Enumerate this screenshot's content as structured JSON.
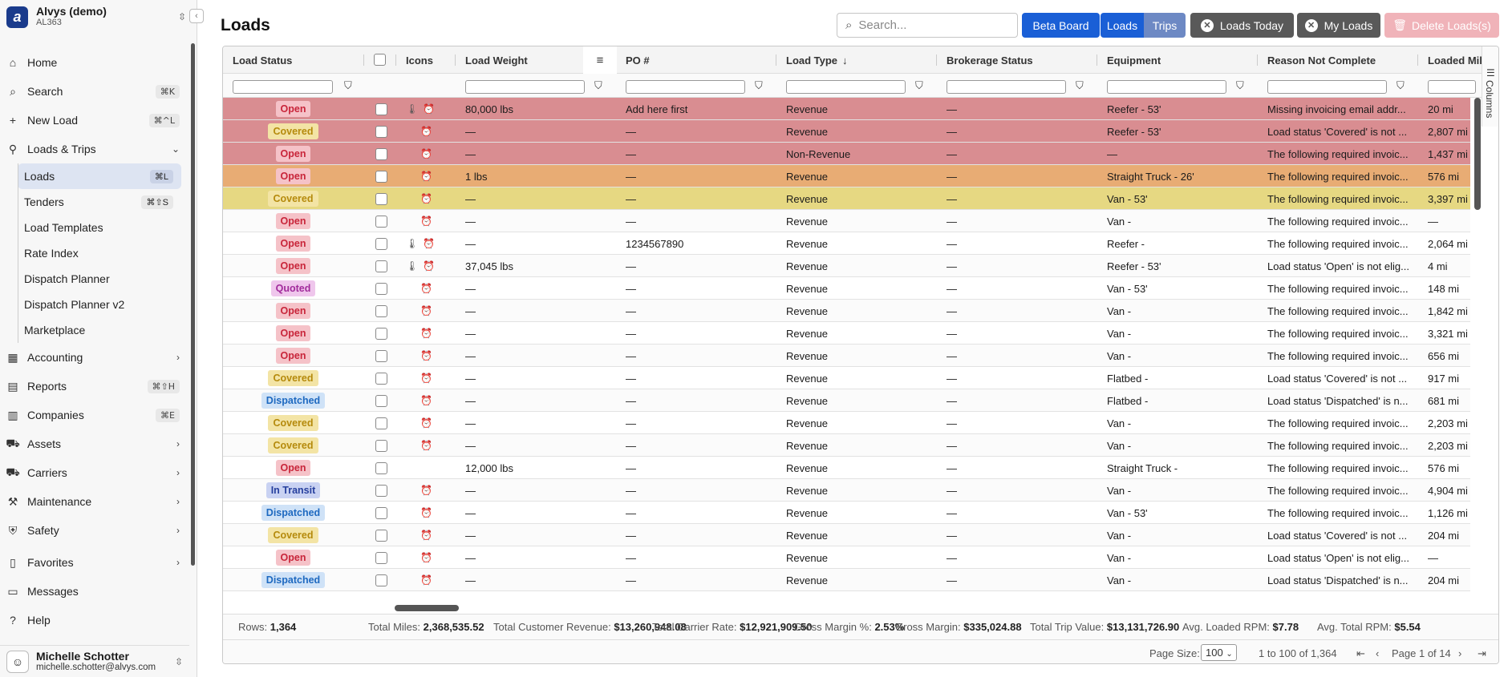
{
  "org": {
    "name": "Alvys (demo)",
    "code": "AL363"
  },
  "nav": {
    "home": {
      "label": "Home"
    },
    "search": {
      "label": "Search",
      "kbd": "⌘K"
    },
    "new_load": {
      "label": "New Load",
      "kbd": "⌘^L"
    },
    "loads_trips": {
      "label": "Loads & Trips"
    },
    "sub": [
      {
        "label": "Loads",
        "kbd": "⌘L"
      },
      {
        "label": "Tenders",
        "kbd": "⌘⇧S"
      },
      {
        "label": "Load Templates"
      },
      {
        "label": "Rate Index"
      },
      {
        "label": "Dispatch Planner"
      },
      {
        "label": "Dispatch Planner v2"
      },
      {
        "label": "Marketplace"
      }
    ],
    "accounting": {
      "label": "Accounting"
    },
    "reports": {
      "label": "Reports",
      "kbd": "⌘⇧H"
    },
    "companies": {
      "label": "Companies",
      "kbd": "⌘E"
    },
    "assets": {
      "label": "Assets"
    },
    "carriers": {
      "label": "Carriers"
    },
    "maintenance": {
      "label": "Maintenance"
    },
    "safety": {
      "label": "Safety"
    },
    "favorites": {
      "label": "Favorites"
    },
    "messages": {
      "label": "Messages"
    },
    "help": {
      "label": "Help"
    }
  },
  "user": {
    "name": "Michelle Schotter",
    "email": "michelle.schotter@alvys.com"
  },
  "page": {
    "title": "Loads"
  },
  "toolbar": {
    "search_placeholder": "Search...",
    "beta_board": "Beta Board",
    "loads": "Loads",
    "trips": "Trips",
    "loads_today": "Loads Today",
    "my_loads": "My Loads",
    "delete_loads": "Delete Loads(s)"
  },
  "columns": {
    "load_status": "Load Status",
    "icons": "Icons",
    "load_weight": "Load Weight",
    "po": "PO #",
    "load_type": "Load Type",
    "brokerage_status": "Brokerage Status",
    "equipment": "Equipment",
    "reason": "Reason Not Complete",
    "loaded_miles": "Loaded Mile",
    "columns_tab": "Columns"
  },
  "colors": {
    "row_red": "#d98d91",
    "row_orange": "#e8ac74",
    "row_yellow": "#e6d882",
    "accent": "#1a5fd6"
  },
  "rows": [
    {
      "status": "Open",
      "st": "open",
      "icons": [
        "thermo",
        "alarm"
      ],
      "weight": "80,000 lbs",
      "po": "Add here first",
      "type": "Revenue",
      "brokerage": "—",
      "equipment": "Reefer - 53'",
      "reason": "Missing invoicing email addr...",
      "miles": "20 mi",
      "tint": "red"
    },
    {
      "status": "Covered",
      "st": "covered",
      "icons": [
        "alarm"
      ],
      "weight": "—",
      "po": "—",
      "type": "Revenue",
      "brokerage": "—",
      "equipment": "Reefer - 53'",
      "reason": "Load status 'Covered' is not ...",
      "miles": "2,807 mi",
      "tint": "red"
    },
    {
      "status": "Open",
      "st": "open",
      "icons": [
        "alarm"
      ],
      "weight": "—",
      "po": "—",
      "type": "Non-Revenue",
      "brokerage": "—",
      "equipment": "—",
      "reason": "The following required invoic...",
      "miles": "1,437 mi",
      "tint": "red"
    },
    {
      "status": "Open",
      "st": "open",
      "icons": [
        "alarm"
      ],
      "weight": "1 lbs",
      "po": "—",
      "type": "Revenue",
      "brokerage": "—",
      "equipment": "Straight Truck - 26'",
      "reason": "The following required invoic...",
      "miles": "576 mi",
      "tint": "orange"
    },
    {
      "status": "Covered",
      "st": "covered",
      "icons": [
        "alarm"
      ],
      "weight": "—",
      "po": "—",
      "type": "Revenue",
      "brokerage": "—",
      "equipment": "Van - 53'",
      "reason": "The following required invoic...",
      "miles": "3,397 mi",
      "tint": "yellow"
    },
    {
      "status": "Open",
      "st": "open",
      "icons": [
        "alarm"
      ],
      "weight": "—",
      "po": "—",
      "type": "Revenue",
      "brokerage": "—",
      "equipment": "Van -",
      "reason": "The following required invoic...",
      "miles": "—",
      "tint": ""
    },
    {
      "status": "Open",
      "st": "open",
      "icons": [
        "thermo",
        "alarm"
      ],
      "weight": "—",
      "po": "1234567890",
      "type": "Revenue",
      "brokerage": "—",
      "equipment": "Reefer -",
      "reason": "The following required invoic...",
      "miles": "2,064 mi",
      "tint": ""
    },
    {
      "status": "Open",
      "st": "open",
      "icons": [
        "thermo",
        "alarm"
      ],
      "weight": "37,045 lbs",
      "po": "—",
      "type": "Revenue",
      "brokerage": "—",
      "equipment": "Reefer - 53'",
      "reason": "Load status 'Open' is not elig...",
      "miles": "4 mi",
      "tint": ""
    },
    {
      "status": "Quoted",
      "st": "quoted",
      "icons": [
        "alarm"
      ],
      "weight": "—",
      "po": "—",
      "type": "Revenue",
      "brokerage": "—",
      "equipment": "Van - 53'",
      "reason": "The following required invoic...",
      "miles": "148 mi",
      "tint": ""
    },
    {
      "status": "Open",
      "st": "open",
      "icons": [
        "alarm"
      ],
      "weight": "—",
      "po": "—",
      "type": "Revenue",
      "brokerage": "—",
      "equipment": "Van -",
      "reason": "The following required invoic...",
      "miles": "1,842 mi",
      "tint": ""
    },
    {
      "status": "Open",
      "st": "open",
      "icons": [
        "alarm"
      ],
      "weight": "—",
      "po": "—",
      "type": "Revenue",
      "brokerage": "—",
      "equipment": "Van -",
      "reason": "The following required invoic...",
      "miles": "3,321 mi",
      "tint": ""
    },
    {
      "status": "Open",
      "st": "open",
      "icons": [
        "alarm"
      ],
      "weight": "—",
      "po": "—",
      "type": "Revenue",
      "brokerage": "—",
      "equipment": "Van -",
      "reason": "The following required invoic...",
      "miles": "656 mi",
      "tint": ""
    },
    {
      "status": "Covered",
      "st": "covered",
      "icons": [
        "alarm"
      ],
      "weight": "—",
      "po": "—",
      "type": "Revenue",
      "brokerage": "—",
      "equipment": "Flatbed -",
      "reason": "Load status 'Covered' is not ...",
      "miles": "917 mi",
      "tint": ""
    },
    {
      "status": "Dispatched",
      "st": "dispatched",
      "icons": [
        "alarm"
      ],
      "weight": "—",
      "po": "—",
      "type": "Revenue",
      "brokerage": "—",
      "equipment": "Flatbed -",
      "reason": "Load status 'Dispatched' is n...",
      "miles": "681 mi",
      "tint": ""
    },
    {
      "status": "Covered",
      "st": "covered",
      "icons": [
        "alarm"
      ],
      "weight": "—",
      "po": "—",
      "type": "Revenue",
      "brokerage": "—",
      "equipment": "Van -",
      "reason": "The following required invoic...",
      "miles": "2,203 mi",
      "tint": ""
    },
    {
      "status": "Covered",
      "st": "covered",
      "icons": [
        "alarm"
      ],
      "weight": "—",
      "po": "—",
      "type": "Revenue",
      "brokerage": "—",
      "equipment": "Van -",
      "reason": "The following required invoic...",
      "miles": "2,203 mi",
      "tint": ""
    },
    {
      "status": "Open",
      "st": "open",
      "icons": [],
      "weight": "12,000 lbs",
      "po": "—",
      "type": "Revenue",
      "brokerage": "—",
      "equipment": "Straight Truck -",
      "reason": "The following required invoic...",
      "miles": "576 mi",
      "tint": ""
    },
    {
      "status": "In Transit",
      "st": "transit",
      "icons": [
        "alarm"
      ],
      "weight": "—",
      "po": "—",
      "type": "Revenue",
      "brokerage": "—",
      "equipment": "Van -",
      "reason": "The following required invoic...",
      "miles": "4,904 mi",
      "tint": ""
    },
    {
      "status": "Dispatched",
      "st": "dispatched",
      "icons": [
        "alarm"
      ],
      "weight": "—",
      "po": "—",
      "type": "Revenue",
      "brokerage": "—",
      "equipment": "Van - 53'",
      "reason": "The following required invoic...",
      "miles": "1,126 mi",
      "tint": ""
    },
    {
      "status": "Covered",
      "st": "covered",
      "icons": [
        "alarm"
      ],
      "weight": "—",
      "po": "—",
      "type": "Revenue",
      "brokerage": "—",
      "equipment": "Van -",
      "reason": "Load status 'Covered' is not ...",
      "miles": "204 mi",
      "tint": ""
    },
    {
      "status": "Open",
      "st": "open",
      "icons": [
        "alarm"
      ],
      "weight": "—",
      "po": "—",
      "type": "Revenue",
      "brokerage": "—",
      "equipment": "Van -",
      "reason": "Load status 'Open' is not elig...",
      "miles": "—",
      "tint": ""
    },
    {
      "status": "Dispatched",
      "st": "dispatched",
      "icons": [
        "alarm"
      ],
      "weight": "—",
      "po": "—",
      "type": "Revenue",
      "brokerage": "—",
      "equipment": "Van -",
      "reason": "Load status 'Dispatched' is n...",
      "miles": "204 mi",
      "tint": ""
    }
  ],
  "summary": {
    "rows_label": "Rows:",
    "rows": "1,364",
    "miles_label": "Total Miles:",
    "miles": "2,368,535.52",
    "revenue_label": "Total Customer Revenue:",
    "revenue": "$13,260,948.08",
    "carrier_label": "Total Carrier Rate:",
    "carrier": "$12,921,909.50",
    "margin_pct_label": "Gross Margin %:",
    "margin_pct": "2.53%",
    "margin_label": "Gross Margin:",
    "margin": "$335,024.88",
    "trip_label": "Total Trip Value:",
    "trip": "$13,131,726.90",
    "loaded_rpm_label": "Avg. Loaded RPM:",
    "loaded_rpm": "$7.78",
    "total_rpm_label": "Avg. Total RPM:",
    "total_rpm": "$5.54"
  },
  "pager": {
    "page_size_label": "Page Size:",
    "page_size": "100",
    "range": "1 to 100 of 1,364",
    "page_info": "Page 1 of 14"
  }
}
